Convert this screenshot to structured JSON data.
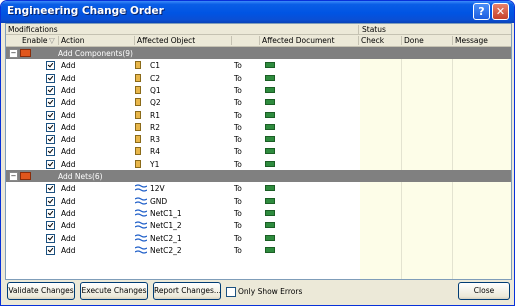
{
  "window": {
    "title": "Engineering Change Order"
  },
  "header": {
    "group_left": "Modifications",
    "group_right": "Status",
    "columns": {
      "enable": "Enable",
      "sort_arrow": "▽",
      "action": "Action",
      "affected_object": "Affected Object",
      "affected_document": "Affected Document",
      "check": "Check",
      "done": "Done",
      "message": "Message"
    }
  },
  "groups": [
    {
      "name": "Add Components(9)",
      "rows": [
        {
          "action": "Add",
          "object": "C1",
          "to": "To"
        },
        {
          "action": "Add",
          "object": "C2",
          "to": "To"
        },
        {
          "action": "Add",
          "object": "Q1",
          "to": "To"
        },
        {
          "action": "Add",
          "object": "Q2",
          "to": "To"
        },
        {
          "action": "Add",
          "object": "R1",
          "to": "To"
        },
        {
          "action": "Add",
          "object": "R2",
          "to": "To"
        },
        {
          "action": "Add",
          "object": "R3",
          "to": "To"
        },
        {
          "action": "Add",
          "object": "R4",
          "to": "To"
        },
        {
          "action": "Add",
          "object": "Y1",
          "to": "To"
        }
      ]
    },
    {
      "name": "Add Nets(6)",
      "rows": [
        {
          "action": "Add",
          "object": "12V",
          "to": "To"
        },
        {
          "action": "Add",
          "object": "GND",
          "to": "To"
        },
        {
          "action": "Add",
          "object": "NetC1_1",
          "to": "To"
        },
        {
          "action": "Add",
          "object": "NetC1_2",
          "to": "To"
        },
        {
          "action": "Add",
          "object": "NetC2_1",
          "to": "To"
        },
        {
          "action": "Add",
          "object": "NetC2_2",
          "to": "To"
        }
      ]
    }
  ],
  "buttons": {
    "validate": "Validate Changes",
    "execute": "Execute Changes",
    "report": "Report Changes...",
    "close": "Close"
  },
  "only_show_errors": {
    "label": "Only Show Errors",
    "checked": false
  }
}
